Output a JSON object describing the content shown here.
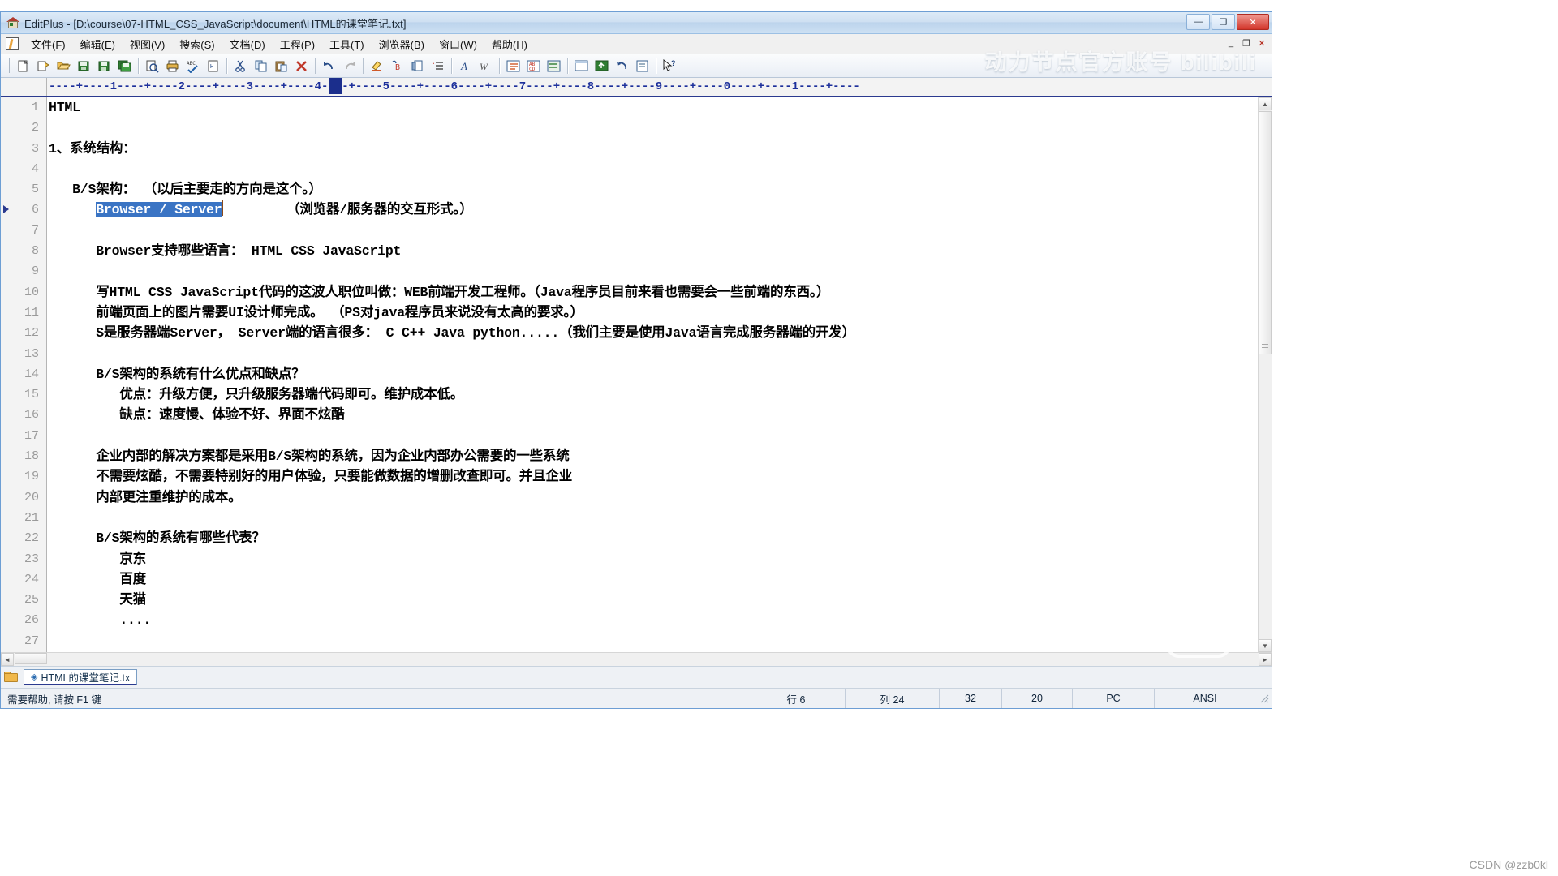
{
  "window": {
    "title": "EditPlus - [D:\\course\\07-HTML_CSS_JavaScript\\document\\HTML的课堂笔记.txt]",
    "app_icon": "editplus-icon",
    "minimize_label": "—",
    "maximize_label": "❐",
    "close_label": "✕",
    "mdi_minimize": "_",
    "mdi_restore": "❐",
    "mdi_close": "✕"
  },
  "menu": {
    "items": [
      {
        "label": "文件(F)",
        "name": "menu-file"
      },
      {
        "label": "编辑(E)",
        "name": "menu-edit"
      },
      {
        "label": "视图(V)",
        "name": "menu-view"
      },
      {
        "label": "搜索(S)",
        "name": "menu-search"
      },
      {
        "label": "文档(D)",
        "name": "menu-document"
      },
      {
        "label": "工程(P)",
        "name": "menu-project"
      },
      {
        "label": "工具(T)",
        "name": "menu-tools"
      },
      {
        "label": "浏览器(B)",
        "name": "menu-browser"
      },
      {
        "label": "窗口(W)",
        "name": "menu-window"
      },
      {
        "label": "帮助(H)",
        "name": "menu-help"
      }
    ]
  },
  "toolbar": {
    "buttons": [
      "new-file-icon",
      "new-from-template-icon",
      "open-file-icon",
      "open-remote-icon",
      "save-icon",
      "save-all-icon",
      "sep",
      "print-preview-icon",
      "print-icon",
      "spell-check-icon",
      "html-page-icon",
      "sep",
      "cut-icon",
      "copy-icon",
      "paste-icon",
      "delete-icon",
      "sep",
      "undo-icon",
      "redo-icon",
      "sep",
      "highlight-icon",
      "find-icon",
      "replace-icon",
      "goto-line-icon",
      "sep",
      "font-icon",
      "word-wrap-icon",
      "sep",
      "line-numbers-icon",
      "show-spaces-icon",
      "user-tools-icon",
      "sep",
      "browser-preview-icon",
      "ftp-upload-icon",
      "back-icon",
      "forward-icon",
      "sep",
      "help-pointer-icon"
    ]
  },
  "ruler": {
    "scale": "----+----1----+----2----+----3----+----4----+----5----+----6----+----7----+----8----+----9----+----0----+----1----+----",
    "caret_column_marker": true
  },
  "editor": {
    "line_count_visible": 27,
    "first_line": 1,
    "bookmark_line": 6,
    "lines": [
      {
        "n": "1",
        "text": "HTML"
      },
      {
        "n": "2",
        "text": ""
      },
      {
        "n": "3",
        "text": "1、系统结构："
      },
      {
        "n": "4",
        "text": ""
      },
      {
        "n": "5",
        "text": "   B/S架构： （以后主要走的方向是这个。）"
      },
      {
        "n": "6",
        "pre": "      ",
        "selected": "Browser / Server",
        "post": "        （浏览器/服务器的交互形式。）"
      },
      {
        "n": "7",
        "text": ""
      },
      {
        "n": "8",
        "text": "      Browser支持哪些语言： HTML CSS JavaScript"
      },
      {
        "n": "9",
        "text": ""
      },
      {
        "n": "10",
        "text": "      写HTML CSS JavaScript代码的这波人职位叫做：WEB前端开发工程师。（Java程序员目前来看也需要会一些前端的东西。）"
      },
      {
        "n": "11",
        "text": "      前端页面上的图片需要UI设计师完成。 （PS对java程序员来说没有太高的要求。）"
      },
      {
        "n": "12",
        "text": "      S是服务器端Server， Server端的语言很多： C C++ Java python.....（我们主要是使用Java语言完成服务器端的开发）"
      },
      {
        "n": "13",
        "text": ""
      },
      {
        "n": "14",
        "text": "      B/S架构的系统有什么优点和缺点？"
      },
      {
        "n": "15",
        "text": "         优点：升级方便，只升级服务器端代码即可。维护成本低。"
      },
      {
        "n": "16",
        "text": "         缺点：速度慢、体验不好、界面不炫酷"
      },
      {
        "n": "17",
        "text": ""
      },
      {
        "n": "18",
        "text": "      企业内部的解决方案都是采用B/S架构的系统，因为企业内部办公需要的一些系统"
      },
      {
        "n": "19",
        "text": "      不需要炫酷，不需要特别好的用户体验，只要能做数据的增删改查即可。并且企业"
      },
      {
        "n": "20",
        "text": "      内部更注重维护的成本。"
      },
      {
        "n": "21",
        "text": ""
      },
      {
        "n": "22",
        "text": "      B/S架构的系统有哪些代表？"
      },
      {
        "n": "23",
        "text": "         京东"
      },
      {
        "n": "24",
        "text": "         百度"
      },
      {
        "n": "25",
        "text": "         天猫"
      },
      {
        "n": "26",
        "text": "         ...."
      },
      {
        "n": "27",
        "text": ""
      }
    ]
  },
  "tabbar": {
    "folder_icon": "folder-icon",
    "tabs": [
      {
        "marker": "◈",
        "label": "HTML的课堂笔记.tx"
      }
    ]
  },
  "statusbar": {
    "help_text": "需要帮助, 请按 F1 键",
    "cells": [
      {
        "name": "status-row",
        "value": "行 6"
      },
      {
        "name": "status-column",
        "value": "列 24"
      },
      {
        "name": "status-chars",
        "value": "32"
      },
      {
        "name": "status-sel",
        "value": "20"
      },
      {
        "name": "status-linetype",
        "value": "PC"
      },
      {
        "name": "status-encoding",
        "value": "ANSI"
      }
    ]
  },
  "watermarks": {
    "bilibili": "动力节点官方账号 bilibili",
    "csdn": "CSDN @zzb0kl"
  },
  "colors": {
    "selection": "#3a74c4",
    "ruler_text": "#1c2f9b",
    "gutter_text": "#9a9a9a",
    "title_accent": "#bcd4ec",
    "close_red": "#d2352a"
  }
}
